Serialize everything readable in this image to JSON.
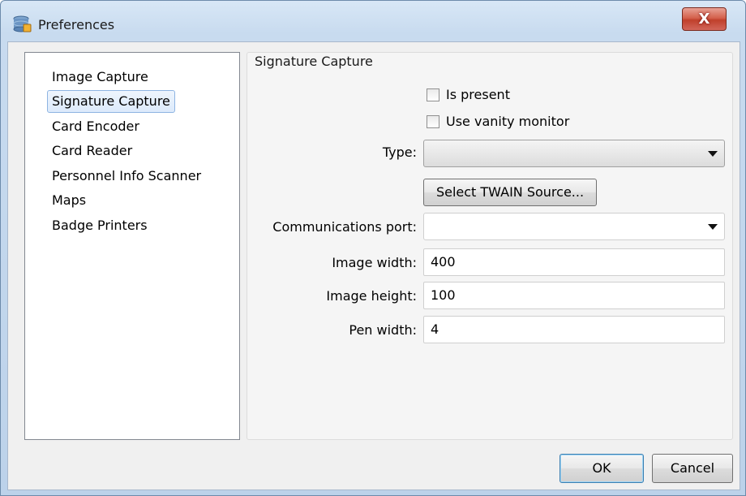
{
  "window": {
    "title": "Preferences",
    "close_glyph": "X",
    "app_icon": "database-icon"
  },
  "nav": {
    "items": [
      {
        "label": "Image Capture"
      },
      {
        "label": "Signature Capture",
        "selected": true
      },
      {
        "label": "Card Encoder"
      },
      {
        "label": "Card Reader"
      },
      {
        "label": "Personnel Info Scanner"
      },
      {
        "label": "Maps"
      },
      {
        "label": "Badge Printers"
      }
    ]
  },
  "panel": {
    "title": "Signature Capture",
    "is_present": {
      "label": "Is present",
      "checked": false
    },
    "vanity_monitor": {
      "label": "Use vanity monitor",
      "checked": false
    },
    "type": {
      "label": "Type:",
      "value": ""
    },
    "twain_button": "Select TWAIN Source...",
    "comm_port": {
      "label": "Communications port:",
      "value": ""
    },
    "image_width": {
      "label": "Image width:",
      "value": "400"
    },
    "image_height": {
      "label": "Image height:",
      "value": "100"
    },
    "pen_width": {
      "label": "Pen width:",
      "value": "4"
    }
  },
  "footer": {
    "ok": "OK",
    "cancel": "Cancel"
  },
  "colors": {
    "selection_border": "#8eb4e2",
    "close_button": "#c0402b",
    "default_button_border": "#3c7fb1"
  }
}
